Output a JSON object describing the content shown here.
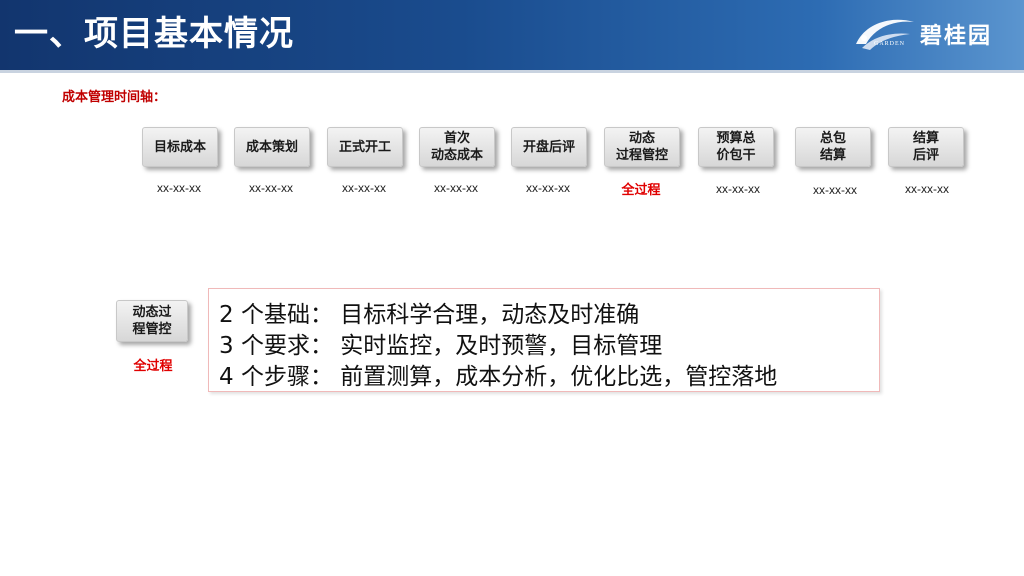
{
  "header": {
    "title": "一、项目基本情况",
    "logo_text": "碧桂园",
    "logo_sub": "GARDEN"
  },
  "timeline": {
    "label": "成本管理时间轴：",
    "steps": [
      {
        "label": "目标成本",
        "date": "xx-xx-xx"
      },
      {
        "label": "成本策划",
        "date": "xx-xx-xx"
      },
      {
        "label": "正式开工",
        "date": "xx-xx-xx"
      },
      {
        "label": "首次\n动态成本",
        "date": "xx-xx-xx"
      },
      {
        "label": "开盘后评",
        "date": "xx-xx-xx"
      },
      {
        "label": "动态\n过程管控",
        "date": "全过程"
      },
      {
        "label": "预算总\n价包干",
        "date": "xx-xx-xx"
      },
      {
        "label": "总包\n结算",
        "date": "xx-xx-xx"
      },
      {
        "label": "结算\n后评",
        "date": "xx-xx-xx"
      }
    ]
  },
  "summary": {
    "badge": "动态过\n程管控",
    "badge_note": "全过程",
    "lines": [
      "2 个基础：  目标科学合理，动态及时准确",
      "3 个要求：  实时监控，及时预警，目标管理",
      "4 个步骤：  前置测算，成本分析，优化比选，管控落地"
    ]
  },
  "colors": {
    "accent_red": "#c00000",
    "header_blue": "#1a4c8e"
  }
}
